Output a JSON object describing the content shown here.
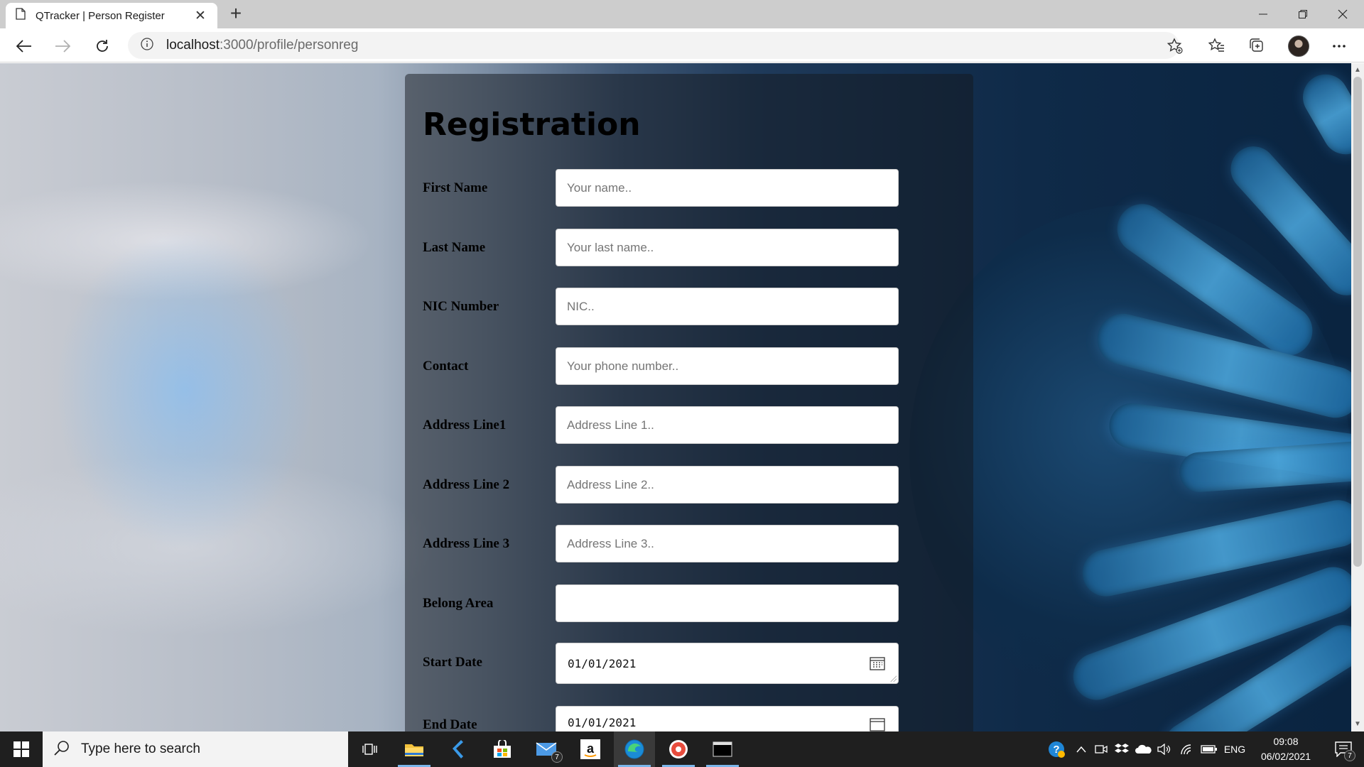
{
  "browser": {
    "tab_title": "QTracker | Person Register",
    "url_host": "localhost",
    "url_path": ":3000/profile/personreg"
  },
  "form": {
    "title": "Registration",
    "fields": [
      {
        "label": "First Name",
        "placeholder": "Your name.."
      },
      {
        "label": "Last Name",
        "placeholder": "Your last name.."
      },
      {
        "label": "NIC Number",
        "placeholder": "NIC.."
      },
      {
        "label": "Contact",
        "placeholder": "Your phone number.."
      },
      {
        "label": "Address Line1",
        "placeholder": "Address Line 1.."
      },
      {
        "label": "Address Line 2",
        "placeholder": "Address Line 2.."
      },
      {
        "label": "Address Line 3",
        "placeholder": "Address Line 3.."
      },
      {
        "label": "Belong Area",
        "placeholder": ""
      }
    ],
    "start_date": {
      "label": "Start Date",
      "value": "01/01/2021"
    },
    "end_date": {
      "label": "End Date",
      "value": "01/01/2021"
    }
  },
  "taskbar": {
    "search_placeholder": "Type here to search",
    "mail_badge": "7",
    "language": "ENG",
    "time": "09:08",
    "date": "06/02/2021",
    "notification_count": "7"
  },
  "colors": {
    "accent": "#7bb6ea",
    "taskbar": "#1f1f1f",
    "panel": "rgba(20,24,30,0.5)"
  }
}
